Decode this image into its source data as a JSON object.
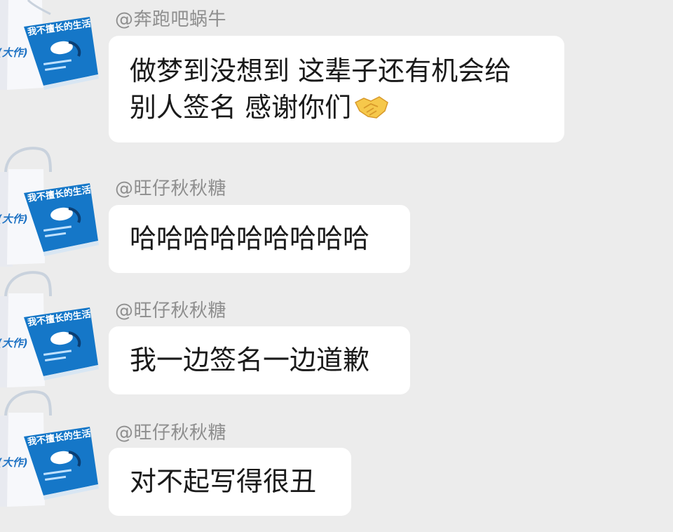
{
  "messages": [
    {
      "sender": "@奔跑吧蜗牛",
      "lines": [
        "做梦到没想到 这辈子还有机会给",
        "别人签名 感谢你们"
      ],
      "emoji": "handshake-emoji"
    },
    {
      "sender": "@旺仔秋秋糖",
      "lines": [
        "哈哈哈哈哈哈哈哈哈"
      ]
    },
    {
      "sender": "@旺仔秋秋糖",
      "lines": [
        "我一边签名一边道歉"
      ]
    },
    {
      "sender": "@旺仔秋秋糖",
      "lines": [
        "对不起写得很丑"
      ]
    }
  ],
  "avatar": {
    "book_title": "我不擅长的生活",
    "bag_text": "(大作)",
    "book_color": "#2a86d4",
    "bag_color": "#ffffff"
  },
  "colors": {
    "background": "#ececec",
    "bubble": "#ffffff",
    "sender_text": "#8e8e8e",
    "message_text": "#1a1a1a"
  }
}
